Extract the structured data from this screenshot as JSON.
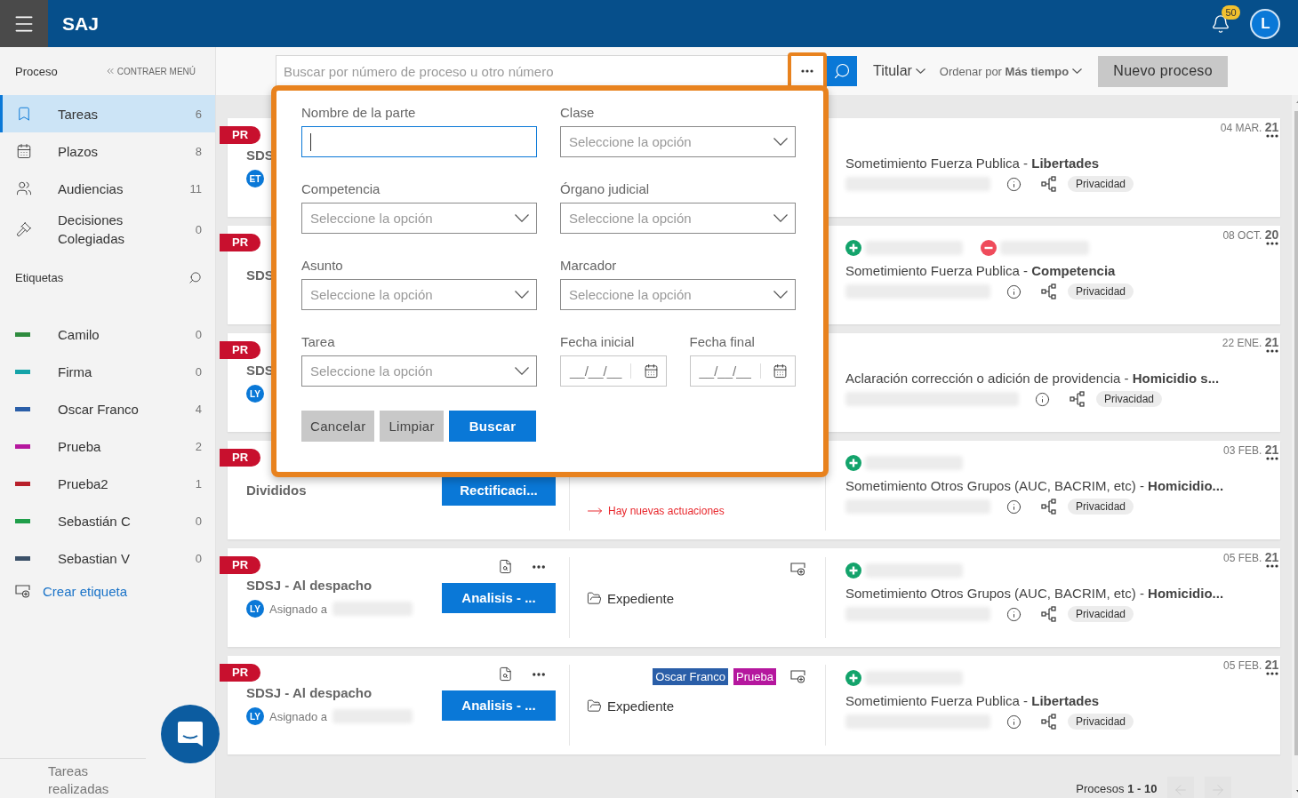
{
  "header": {
    "logo": "SAJ",
    "notification_count": "50",
    "avatar": "L"
  },
  "sidebar": {
    "title": "Proceso",
    "collapse_label": "CONTRAER MENÚ",
    "items": [
      {
        "label": "Tareas",
        "count": "6",
        "selected": true
      },
      {
        "label": "Plazos",
        "count": "8",
        "selected": false
      },
      {
        "label": "Audiencias",
        "count": "11",
        "selected": false
      },
      {
        "label": "Decisiones Colegiadas",
        "count": "0",
        "selected": false
      }
    ],
    "tags_title": "Etiquetas",
    "tags": [
      {
        "name": "Camilo",
        "count": "0",
        "color": "#2e8b3e"
      },
      {
        "name": "Firma",
        "count": "0",
        "color": "#14a3a8"
      },
      {
        "name": "Oscar Franco",
        "count": "4",
        "color": "#2a5ea8"
      },
      {
        "name": "Prueba",
        "count": "2",
        "color": "#b5179e"
      },
      {
        "name": "Prueba2",
        "count": "1",
        "color": "#b81f2a"
      },
      {
        "name": "Sebastián C",
        "count": "0",
        "color": "#1f9e4a"
      },
      {
        "name": "Sebastian V",
        "count": "0",
        "color": "#3b5068"
      }
    ],
    "create_tag": "Crear etiqueta",
    "footer": "Tareas realizadas"
  },
  "toolbar": {
    "search_placeholder": "Buscar por número de proceso u otro número",
    "more_highlighted": true,
    "filter": "Titular",
    "sort_label": "Ordenar por **Más tiempo**",
    "new_button": "Nuevo proceso"
  },
  "filter_panel": {
    "fields": [
      {
        "kind": "text",
        "label": "Nombre de la parte",
        "focused": true
      },
      {
        "kind": "select",
        "label": "Clase",
        "placeholder": "Seleccione la opción",
        "focused": false
      },
      {
        "kind": "select",
        "label": "Competencia",
        "placeholder": "Seleccione la opción",
        "focused": false
      },
      {
        "kind": "select",
        "label": "Órgano judicial",
        "placeholder": "Seleccione la opción",
        "focused": false
      },
      {
        "kind": "select",
        "label": "Asunto",
        "placeholder": "Seleccione la opción",
        "focused": false
      },
      {
        "kind": "select",
        "label": "Marcador",
        "placeholder": "Seleccione la opción",
        "focused": false
      },
      {
        "kind": "select",
        "label": "Tarea",
        "placeholder": "Seleccione la opción",
        "focused": false
      },
      {
        "kind": "date",
        "label": "Fecha inicial",
        "placeholder": "__/__/__",
        "focused": false
      },
      {
        "kind": "date",
        "label": "Fecha final",
        "placeholder": "__/__/__",
        "focused": false
      }
    ],
    "buttons": [
      {
        "label": "Cancelar",
        "kind": "secondary"
      },
      {
        "label": "Limpiar",
        "kind": "secondary"
      },
      {
        "label": "Buscar",
        "kind": "primary"
      }
    ]
  },
  "cards": [
    {
      "ribbon": "PR",
      "title": "SDS",
      "avatar": "ET",
      "right": {
        "title": "Sometimiento Fuerza Publica - **Libertades**",
        "chip": "Privacidad",
        "date": "04 MAR.",
        "year": "21"
      }
    },
    {
      "ribbon": "PR",
      "title": "SDS",
      "right": {
        "markers": [
          {
            "kind": "add"
          },
          {
            "kind": "remove"
          }
        ],
        "title": "Sometimiento Fuerza Publica - **Competencia**",
        "chip": "Privacidad",
        "date": "08 OCT.",
        "year": "20"
      }
    },
    {
      "ribbon": "PR",
      "title": "SDS",
      "avatar": "LY",
      "right": {
        "title": "Aclaración corrección o adición de providencia - **Homicidio s...**",
        "chip": "Privacidad",
        "date": "22 ENE.",
        "year": "21"
      }
    },
    {
      "ribbon": "PR",
      "title": "Divididos",
      "button": "Rectificaci...",
      "middle": {
        "alert": "Hay nuevas actuaciones"
      },
      "right": {
        "markers": [
          {
            "kind": "add"
          }
        ],
        "title": "Sometimiento Otros Grupos (AUC, BACRIM, etc) - **Homicidio...**",
        "chip": "Privacidad",
        "date": "03 FEB.",
        "year": "21"
      }
    },
    {
      "ribbon": "PR",
      "title": "SDSJ - Al despacho",
      "avatar": "LY",
      "assigned_label": "Asignado a",
      "actions": true,
      "button": "Analisis - ...",
      "middle": {
        "add_tag": true,
        "folder": "Expediente"
      },
      "right": {
        "markers": [
          {
            "kind": "add"
          }
        ],
        "title": "Sometimiento Otros Grupos (AUC, BACRIM, etc) - **Homicidio...**",
        "chip": "Privacidad",
        "date": "05 FEB.",
        "year": "21"
      }
    },
    {
      "ribbon": "PR",
      "title": "SDSJ - Al despacho",
      "avatar": "LY",
      "assigned_label": "Asignado a",
      "actions": true,
      "button": "Analisis - ...",
      "middle": {
        "add_tag": true,
        "tags": [
          {
            "name": "Oscar Franco",
            "color": "#2a5ea8"
          },
          {
            "name": "Prueba",
            "color": "#b5179e"
          }
        ],
        "folder": "Expediente"
      },
      "right": {
        "markers": [
          {
            "kind": "add"
          }
        ],
        "title": "Sometimiento Fuerza Publica - **Libertades**",
        "chip": "Privacidad",
        "date": "05 FEB.",
        "year": "21"
      }
    }
  ],
  "pagination": {
    "label": "Procesos **1 - 10**",
    "prev_enabled": false,
    "next_enabled": false
  }
}
